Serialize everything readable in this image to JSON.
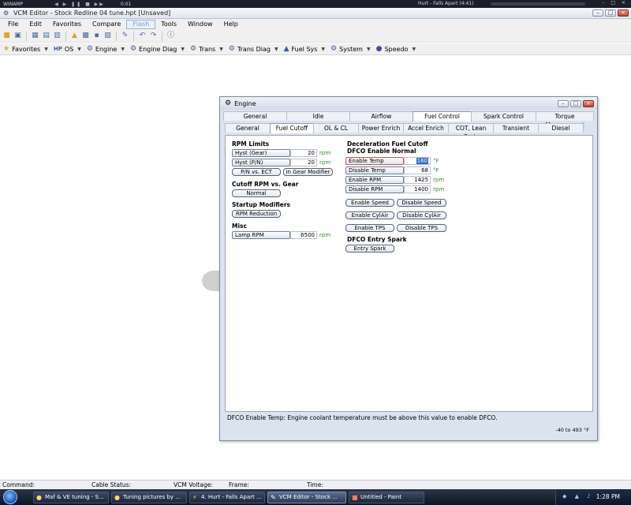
{
  "winamp": {
    "label": "WINAMP",
    "controls": "◀ ▶ ❚❚ ■ ▶▶",
    "time": "0:01",
    "track": "Hurt - Falls Apart (4:41)",
    "buttons": "– □ ×"
  },
  "app": {
    "title": "VCM Editor - Stock Redline 04 tune.hpt   [Unsaved]",
    "min": "–",
    "max": "□",
    "close": "×"
  },
  "menu": [
    "File",
    "Edit",
    "Favorites",
    "Compare",
    "Flash",
    "Tools",
    "Window",
    "Help"
  ],
  "favorites": [
    {
      "label": "Favorites",
      "icon": "★"
    },
    {
      "label": "OS",
      "icon": "HP"
    },
    {
      "label": "Engine",
      "icon": "⚙"
    },
    {
      "label": "Engine Diag",
      "icon": "⚙"
    },
    {
      "label": "Trans",
      "icon": "⚙"
    },
    {
      "label": "Trans Diag",
      "icon": "⚙"
    },
    {
      "label": "Fuel Sys",
      "icon": "▲"
    },
    {
      "label": "System",
      "icon": "⚙"
    },
    {
      "label": "Speedo",
      "icon": "●"
    }
  ],
  "dialog": {
    "title": "Engine",
    "tabs_top": [
      "General",
      "Idle",
      "Airflow",
      "Fuel Control",
      "Spark Control",
      "Torque Management"
    ],
    "tabs_sub": [
      "General",
      "Fuel Cutoff",
      "OL & CL",
      "Power Enrich",
      "Accel Enrich",
      "COT, Lean Cruis",
      "Transient",
      "Diesel"
    ],
    "left": {
      "rpm_limits": "RPM Limits",
      "hyst_gear": {
        "label": "Hyst (Gear)",
        "value": "20",
        "unit": "rpm"
      },
      "hyst_pn": {
        "label": "Hyst (P/N)",
        "value": "20",
        "unit": "rpm"
      },
      "pn_ect": "P/N vs. ECT",
      "in_gear": "In Gear Modifier",
      "cutoff_title": "Cutoff RPM vs. Gear",
      "normal": "Normal",
      "startup_title": "Startup Modifiers",
      "rpm_reduction": "RPM Reduction",
      "misc_title": "Misc",
      "lamp_rpm": {
        "label": "Lamp RPM",
        "value": "6500",
        "unit": "rpm"
      }
    },
    "right": {
      "dfco_title": "Deceleration Fuel Cutoff",
      "dfco_enable_normal": "DFCO Enable Normal",
      "enable_temp": {
        "label": "Enable Temp",
        "value": "160",
        "unit": "°F"
      },
      "disable_temp": {
        "label": "Disable Temp",
        "value": "68",
        "unit": "°F"
      },
      "enable_rpm": {
        "label": "Enable RPM",
        "value": "1425",
        "unit": "rpm"
      },
      "disable_rpm": {
        "label": "Disable RPM",
        "value": "1400",
        "unit": "rpm"
      },
      "enable_speed": "Enable Speed",
      "disable_speed": "Disable Speed",
      "enable_cylair": "Enable CylAir",
      "disable_cylair": "Disable CylAir",
      "enable_tps": "Enable TPS",
      "disable_tps": "Disable TPS",
      "entry_spark_title": "DFCO Entry Spark",
      "entry_spark": "Entry Spark"
    },
    "status_msg": "DFCO Enable Temp: Engine coolant temperature must be above this value to enable DFCO.",
    "range": "-40 to 493 °F"
  },
  "appstatus": {
    "command": "Command:",
    "cable": "Cable Status:",
    "voltage": "VCM Voltage:",
    "frame": "Frame:",
    "time": "Time:"
  },
  "taskbar": {
    "tasks": [
      "Maf & VE tuning - S...",
      "Tuning pictures by ...",
      "4. Hurt - Falls Apart ...",
      "VCM Editor - Stock ...",
      "Untitled - Paint"
    ],
    "clock": "1:28 PM",
    "tray": "◆ ▲ ♪"
  }
}
